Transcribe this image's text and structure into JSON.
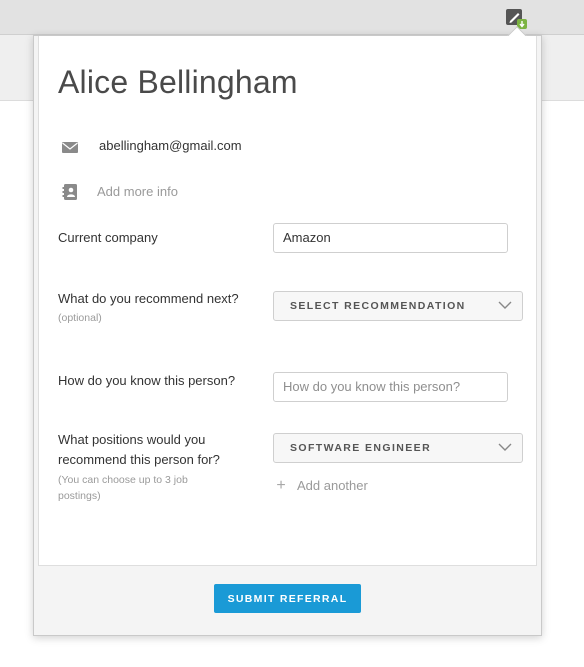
{
  "profile": {
    "name": "Alice Bellingham",
    "email": "abellingham@gmail.com",
    "add_more_info": "Add more info"
  },
  "form": {
    "current_company": {
      "label": "Current company",
      "value": "Amazon"
    },
    "recommend_next": {
      "label": "What do you recommend next?",
      "sublabel": "(optional)",
      "selected": "SELECT RECOMMENDATION"
    },
    "know_person": {
      "label": "How do you know this person?",
      "placeholder": "How do you know this person?"
    },
    "positions": {
      "label_line1": "What positions would you",
      "label_line2": "recommend this person for?",
      "sublabel_line1": "(You can choose up to 3 job",
      "sublabel_line2": "postings)",
      "selected": "SOFTWARE ENGINEER",
      "add_another": "Add another"
    }
  },
  "actions": {
    "submit": "SUBMIT REFERRAL"
  },
  "icons": {
    "edit": "edit-pencil-icon",
    "badge": "download-badge-icon",
    "email": "envelope-icon",
    "contact": "address-book-icon",
    "chevron": "chevron-down-icon",
    "plus": "plus-icon"
  },
  "colors": {
    "accent": "#1a9ad6",
    "badge": "#7cb342"
  }
}
